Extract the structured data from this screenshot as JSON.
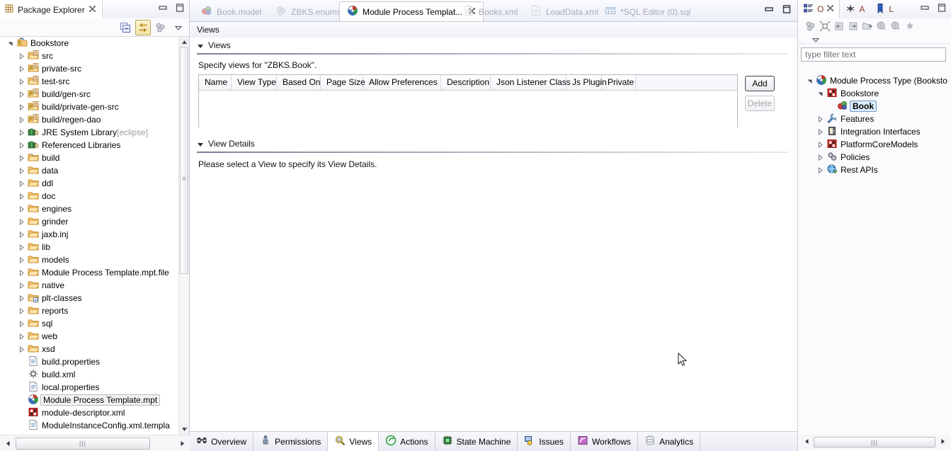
{
  "package_explorer": {
    "tab_label": "Package Explorer",
    "tab_icon": "package-explorer-icon",
    "close_icon": "close-icon",
    "minimize_icon": "minimize-icon",
    "maximize_icon": "maximize-icon",
    "toolbar": [
      {
        "name": "collapse-all-icon",
        "label": "Collapse All"
      },
      {
        "name": "link-with-editor-icon",
        "label": "Link with Editor",
        "active": true
      },
      {
        "name": "view-menu-icon",
        "label": "View Menu"
      },
      {
        "name": "chevron-down-icon",
        "label": "Menu"
      }
    ],
    "tree": [
      {
        "label": "Bookstore",
        "depth": 0,
        "arrow": "expanded",
        "icon": "java-project-icon"
      },
      {
        "label": "src",
        "depth": 1,
        "arrow": "collapsed",
        "icon": "source-folder-icon"
      },
      {
        "label": "private-src",
        "depth": 1,
        "arrow": "collapsed",
        "icon": "source-folder-warning-icon"
      },
      {
        "label": "test-src",
        "depth": 1,
        "arrow": "collapsed",
        "icon": "source-folder-icon"
      },
      {
        "label": "build/gen-src",
        "depth": 1,
        "arrow": "collapsed",
        "icon": "source-folder-warning-icon"
      },
      {
        "label": "build/private-gen-src",
        "depth": 1,
        "arrow": "collapsed",
        "icon": "source-folder-warning-icon"
      },
      {
        "label": "build/regen-dao",
        "depth": 1,
        "arrow": "collapsed",
        "icon": "source-folder-warning-icon"
      },
      {
        "label": "JRE System Library",
        "suffix": " [eclipse]",
        "depth": 1,
        "arrow": "collapsed",
        "icon": "library-icon"
      },
      {
        "label": "Referenced Libraries",
        "depth": 1,
        "arrow": "collapsed",
        "icon": "library-icon"
      },
      {
        "label": "build",
        "depth": 1,
        "arrow": "collapsed",
        "icon": "folder-link-icon"
      },
      {
        "label": "data",
        "depth": 1,
        "arrow": "collapsed",
        "icon": "folder-icon"
      },
      {
        "label": "ddl",
        "depth": 1,
        "arrow": "collapsed",
        "icon": "folder-icon"
      },
      {
        "label": "doc",
        "depth": 1,
        "arrow": "collapsed",
        "icon": "folder-icon"
      },
      {
        "label": "engines",
        "depth": 1,
        "arrow": "collapsed",
        "icon": "folder-icon"
      },
      {
        "label": "grinder",
        "depth": 1,
        "arrow": "collapsed",
        "icon": "folder-icon"
      },
      {
        "label": "jaxb.inj",
        "depth": 1,
        "arrow": "collapsed",
        "icon": "folder-icon"
      },
      {
        "label": "lib",
        "depth": 1,
        "arrow": "collapsed",
        "icon": "folder-icon"
      },
      {
        "label": "models",
        "depth": 1,
        "arrow": "collapsed",
        "icon": "folder-icon"
      },
      {
        "label": "Module Process Template.mpt.file",
        "depth": 1,
        "arrow": "collapsed",
        "icon": "folder-icon"
      },
      {
        "label": "native",
        "depth": 1,
        "arrow": "collapsed",
        "icon": "folder-icon"
      },
      {
        "label": "plt-classes",
        "depth": 1,
        "arrow": "collapsed",
        "icon": "folder-class-icon"
      },
      {
        "label": "reports",
        "depth": 1,
        "arrow": "collapsed",
        "icon": "folder-icon"
      },
      {
        "label": "sql",
        "depth": 1,
        "arrow": "collapsed",
        "icon": "folder-icon"
      },
      {
        "label": "web",
        "depth": 1,
        "arrow": "collapsed",
        "icon": "folder-icon"
      },
      {
        "label": "xsd",
        "depth": 1,
        "arrow": "collapsed",
        "icon": "folder-icon"
      },
      {
        "label": "build.properties",
        "depth": 1,
        "arrow": "none",
        "icon": "properties-file-icon"
      },
      {
        "label": "build.xml",
        "depth": 1,
        "arrow": "none",
        "icon": "ant-file-icon"
      },
      {
        "label": "local.properties",
        "depth": 1,
        "arrow": "none",
        "icon": "properties-file-icon"
      },
      {
        "label": "Module Process Template.mpt",
        "depth": 1,
        "arrow": "none",
        "icon": "mpt-file-icon",
        "selected": true
      },
      {
        "label": "module-descriptor.xml",
        "depth": 1,
        "arrow": "none",
        "icon": "module-descriptor-icon"
      },
      {
        "label": "ModuleInstanceConfig.xml.templa",
        "depth": 1,
        "arrow": "none",
        "icon": "properties-file-icon"
      }
    ],
    "hscroll_grip": "|||",
    "vscroll_grip": "≡"
  },
  "editor": {
    "tabs": [
      {
        "label": "Book.model",
        "icon": "model-file-icon",
        "active": false
      },
      {
        "label": "ZBKS.enums",
        "icon": "enums-file-icon",
        "active": false
      },
      {
        "label": "Module Process Templat...",
        "icon": "mpt-file-icon",
        "active": true,
        "close_icon": "close-icon"
      },
      {
        "label": "Books.xml",
        "icon": "xml-file-icon",
        "active": false
      },
      {
        "label": "LoadData.xml",
        "icon": "xml-file-icon",
        "active": false
      },
      {
        "label": "*SQL Editor (0).sql",
        "icon": "sql-file-icon",
        "active": false
      }
    ],
    "minimize_icon": "minimize-icon",
    "maximize_icon": "maximize-icon",
    "form_title": "Views",
    "sections": {
      "views": {
        "title": "Views",
        "description": "Specify views for \"ZBKS.Book\".",
        "columns": [
          "Name",
          "View Type",
          "Based On",
          "Page Size",
          "Allow Preferences",
          "Description",
          "Json Listener Class",
          "Js Plugin",
          "Private"
        ],
        "rows": [],
        "buttons": {
          "add": "Add",
          "delete": "Delete"
        }
      },
      "view_details": {
        "title": "View Details",
        "message": "Please select a View to specify its View Details."
      }
    },
    "bottom_tabs": [
      {
        "label": "Overview",
        "icon": "overview-icon",
        "active": false
      },
      {
        "label": "Permissions",
        "icon": "permissions-icon",
        "active": false
      },
      {
        "label": "Views",
        "icon": "views-icon",
        "active": true
      },
      {
        "label": "Actions",
        "icon": "actions-icon",
        "active": false
      },
      {
        "label": "State Machine",
        "icon": "state-machine-icon",
        "active": false
      },
      {
        "label": "Issues",
        "icon": "issues-icon",
        "active": false
      },
      {
        "label": "Workflows",
        "icon": "workflows-icon",
        "active": false
      },
      {
        "label": "Analytics",
        "icon": "analytics-icon",
        "active": false
      }
    ]
  },
  "outline": {
    "tabs": [
      {
        "label": "O",
        "icon": "outline-icon",
        "active": true,
        "close_icon": "close-icon"
      },
      {
        "label": "A",
        "icon": "ant-icon",
        "active": false
      },
      {
        "label": "L",
        "icon": "bookmark-icon",
        "active": false
      }
    ],
    "minimize_icon": "minimize-icon",
    "maximize_icon": "maximize-icon",
    "toolbar": [
      {
        "name": "view-menu-icon"
      },
      {
        "name": "collapse-expand-icon"
      },
      {
        "name": "import-left-icon"
      },
      {
        "name": "import-right-icon"
      },
      {
        "name": "export-icon"
      },
      {
        "name": "globe-left-icon"
      },
      {
        "name": "globe-right-icon"
      },
      {
        "name": "delete-star-icon"
      }
    ],
    "menu_arrow_icon": "chevron-down-icon",
    "filter_placeholder": "type filter text",
    "filter_value": "",
    "tree": [
      {
        "label": "Module Process Type (Booksto",
        "depth": 0,
        "arrow": "expanded",
        "icon": "mpt-file-icon"
      },
      {
        "label": "Bookstore",
        "depth": 1,
        "arrow": "expanded",
        "icon": "module-descriptor-icon"
      },
      {
        "label": "Book",
        "depth": 2,
        "arrow": "none",
        "icon": "model-file-icon",
        "selected": true
      },
      {
        "label": "Features",
        "depth": 1,
        "arrow": "collapsed",
        "icon": "features-icon"
      },
      {
        "label": "Integration Interfaces",
        "depth": 1,
        "arrow": "collapsed",
        "icon": "integration-icon"
      },
      {
        "label": "PlatformCoreModels",
        "depth": 1,
        "arrow": "collapsed",
        "icon": "module-descriptor-icon"
      },
      {
        "label": "Policies",
        "depth": 1,
        "arrow": "collapsed",
        "icon": "policies-icon"
      },
      {
        "label": "Rest APIs",
        "depth": 1,
        "arrow": "collapsed",
        "icon": "rest-api-icon"
      }
    ],
    "hscroll_grip": "|||"
  },
  "colors": {
    "accent_selection": "#cde4f7",
    "tab_active_bg": "#ffffff",
    "border": "#c9ccd8",
    "folder_orange": "#f0b25a",
    "link_text": "#9b9b9b"
  }
}
